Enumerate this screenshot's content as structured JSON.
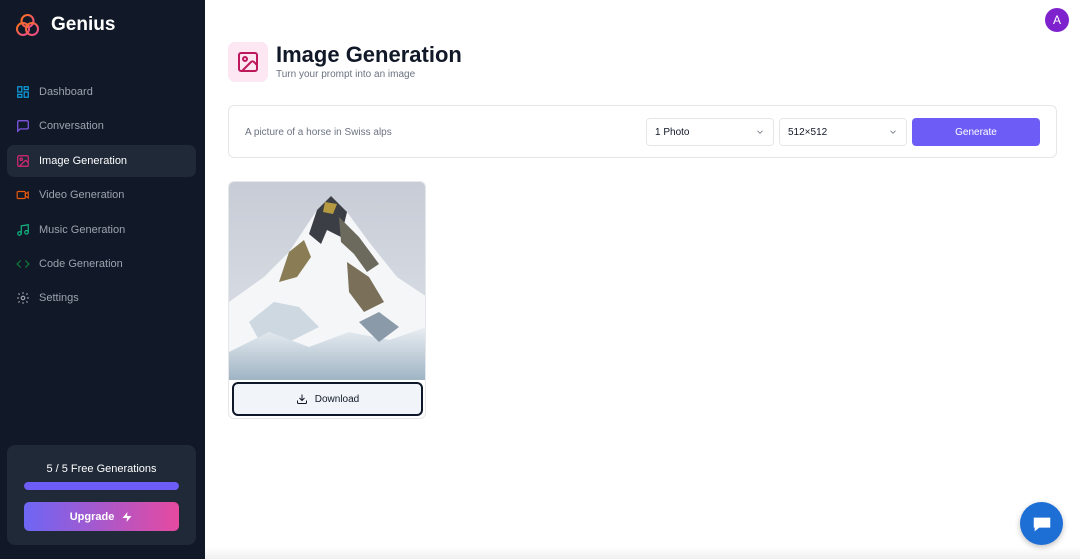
{
  "brand": {
    "name": "Genius"
  },
  "sidebar": {
    "items": [
      {
        "label": "Dashboard",
        "icon": "layout-dashboard-icon",
        "color": "#0ea5e9"
      },
      {
        "label": "Conversation",
        "icon": "message-square-icon",
        "color": "#8b5cf6"
      },
      {
        "label": "Image Generation",
        "icon": "image-icon",
        "color": "#db2777"
      },
      {
        "label": "Video Generation",
        "icon": "video-icon",
        "color": "#ea580c"
      },
      {
        "label": "Music Generation",
        "icon": "music-icon",
        "color": "#10b981"
      },
      {
        "label": "Code Generation",
        "icon": "code-icon",
        "color": "#15803d"
      },
      {
        "label": "Settings",
        "icon": "settings-icon",
        "color": "#9ca3af"
      }
    ],
    "active_item": "Image Generation"
  },
  "usage": {
    "text": "5 / 5 Free Generations",
    "used": 5,
    "limit": 5,
    "progress_fraction": 1.0,
    "upgrade_label": "Upgrade"
  },
  "header": {
    "avatar_letter": "A"
  },
  "page": {
    "title": "Image Generation",
    "subtitle": "Turn your prompt into an image"
  },
  "form": {
    "prompt_placeholder": "A picture of a horse in Swiss alps",
    "amount_value": "1 Photo",
    "resolution_value": "512×512",
    "generate_label": "Generate"
  },
  "result": {
    "download_label": "Download"
  },
  "colors": {
    "sidebar_bg": "#111827",
    "accent": "#6d5df6",
    "image_icon_bg": "#fce7f3",
    "image_icon": "#be185d",
    "avatar": "#7e22ce",
    "chat_button": "#1d6fd6"
  }
}
